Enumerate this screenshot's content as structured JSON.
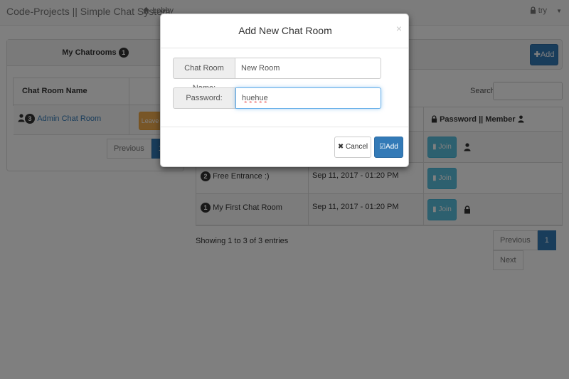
{
  "navbar": {
    "brand": "Code-Projects || Simple Chat System",
    "lobby": "Lobby",
    "user": "try"
  },
  "my_chatrooms": {
    "title": "My Chatrooms",
    "count": "1",
    "column": "Chat Room Name",
    "rows": [
      {
        "members": "3",
        "name": "Admin Chat Room",
        "action": "Leave"
      }
    ],
    "pagination": {
      "previous": "Previous",
      "page": "1"
    }
  },
  "rooms": {
    "add_button": "Add",
    "search_label": "Search:",
    "column_3": "Password || Member",
    "rows": [
      {
        "members": "",
        "name": "",
        "date": "",
        "join": "Join",
        "icon": "user-icon"
      },
      {
        "members": "2",
        "name": "Free Entrance :)",
        "date": "Sep 11, 2017 - 01:20 PM",
        "join": "Join",
        "icon": ""
      },
      {
        "members": "1",
        "name": "My First Chat Room",
        "date": "Sep 11, 2017 - 01:20 PM",
        "join": "Join",
        "icon": "lock-icon"
      }
    ],
    "showing": "Showing 1 to 3 of 3 entries",
    "pagination": {
      "previous": "Previous",
      "page": "1",
      "next": "Next"
    }
  },
  "modal": {
    "title": "Add New Chat Room",
    "close": "×",
    "name_label": "Chat Room Name:",
    "name_value": "New Room",
    "password_label": "Password:",
    "password_value": "huehue",
    "cancel": "Cancel",
    "add": "Add"
  },
  "colors": {
    "primary": "#337ab7",
    "info": "#5bc0de",
    "warning": "#f0ad4e"
  }
}
